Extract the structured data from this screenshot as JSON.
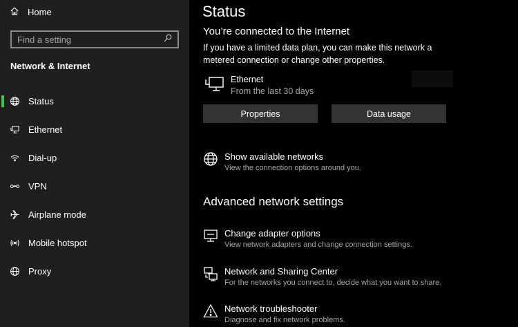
{
  "sidebar": {
    "home_label": "Home",
    "search_placeholder": "Find a setting",
    "section_title": "Network & Internet",
    "accent_color": "#3dc449",
    "items": [
      {
        "label": "Status",
        "icon": "globe-icon",
        "active": true
      },
      {
        "label": "Ethernet",
        "icon": "ethernet-icon"
      },
      {
        "label": "Dial-up",
        "icon": "dial-up-icon"
      },
      {
        "label": "VPN",
        "icon": "vpn-icon"
      },
      {
        "label": "Airplane mode",
        "icon": "airplane-icon"
      },
      {
        "label": "Mobile hotspot",
        "icon": "hotspot-icon"
      },
      {
        "label": "Proxy",
        "icon": "globe-icon"
      }
    ]
  },
  "main": {
    "title": "Status",
    "connection_heading": "You’re connected to the Internet",
    "connection_desc": "If you have a limited data plan, you can make this network a metered connection or change other properties.",
    "adapter": {
      "name": "Ethernet",
      "sub": "From the last 30 days"
    },
    "buttons": {
      "properties": "Properties",
      "data_usage": "Data usage"
    },
    "show_networks": {
      "title": "Show available networks",
      "sub": "View the connection options around you."
    },
    "advanced_heading": "Advanced network settings",
    "advanced": [
      {
        "title": "Change adapter options",
        "sub": "View network adapters and change connection settings.",
        "icon": "adapter-icon"
      },
      {
        "title": "Network and Sharing Center",
        "sub": "For the networks you connect to, decide what you want to share.",
        "icon": "sharing-center-icon"
      },
      {
        "title": "Network troubleshooter",
        "sub": "Diagnose and fix network problems.",
        "icon": "warning-icon"
      }
    ]
  }
}
